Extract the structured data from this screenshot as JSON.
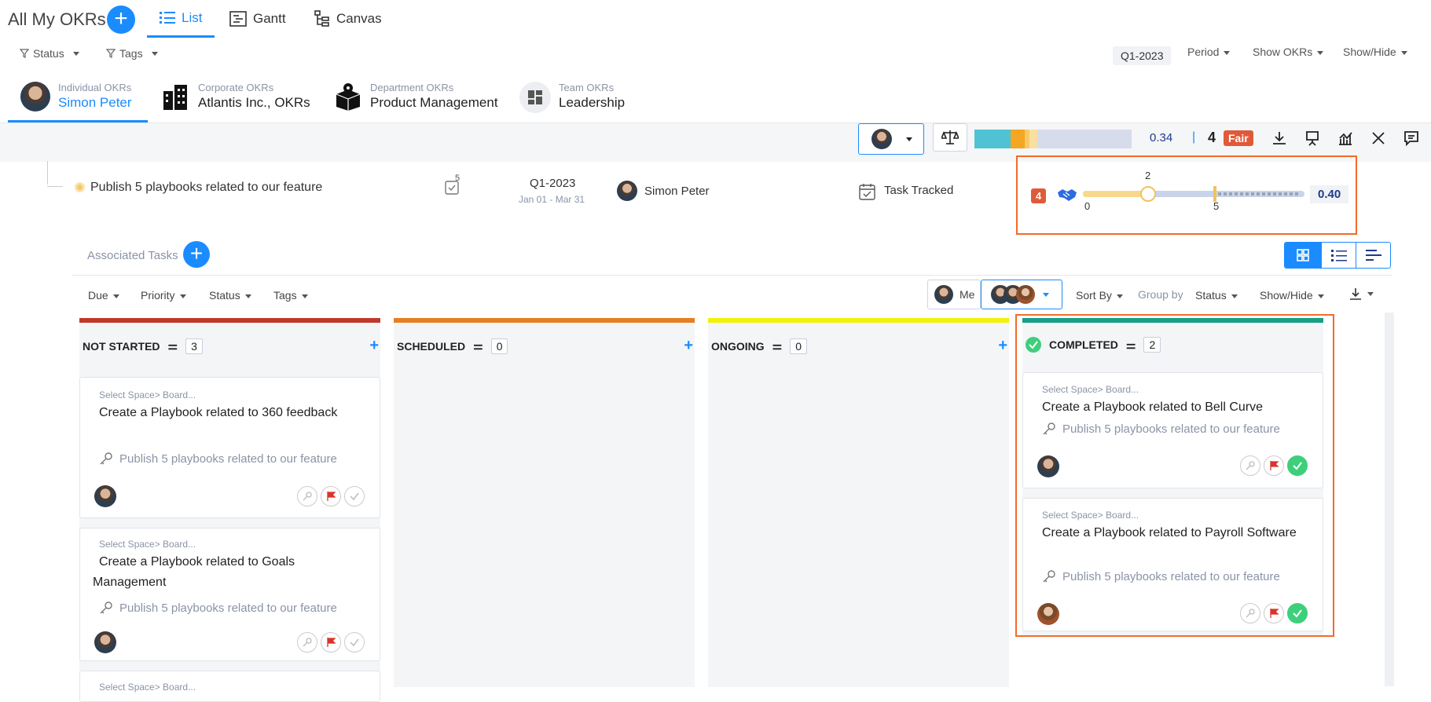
{
  "header": {
    "title": "All My OKRs",
    "tabs": [
      {
        "label": "List",
        "icon": "list-icon"
      },
      {
        "label": "Gantt",
        "icon": "gantt-icon"
      },
      {
        "label": "Canvas",
        "icon": "canvas-icon"
      }
    ]
  },
  "filters": {
    "status": "Status",
    "tags": "Tags",
    "period_value": "Q1-2023",
    "period": "Period",
    "show_okrs": "Show OKRs",
    "show_hide": "Show/Hide"
  },
  "okr_tabs": [
    {
      "sub": "Individual OKRs",
      "main": "Simon Peter"
    },
    {
      "sub": "Corporate OKRs",
      "main": "Atlantis Inc., OKRs"
    },
    {
      "sub": "Department OKRs",
      "main": "Product Management"
    },
    {
      "sub": "Team OKRs",
      "main": "Leadership"
    }
  ],
  "toolbar": {
    "score": "0.34",
    "separator": "|",
    "rating_num": "4",
    "rating_label": "Fair"
  },
  "kr_row": {
    "title": "Publish 5 playbooks related to our feature",
    "task_count": "5",
    "period": "Q1-2023",
    "dates": "Jan 01 - Mar 31",
    "owner": "Simon Peter",
    "tracking": "Task Tracked",
    "badge": "4",
    "slider_current": "2",
    "slider_start": "0",
    "slider_target": "5",
    "slider_fraction": 0.4,
    "score": "0.40"
  },
  "tasks": {
    "title": "Associated Tasks",
    "filters": [
      "Due",
      "Priority",
      "Status",
      "Tags"
    ],
    "me": "Me",
    "sort_by": "Sort By",
    "group_by_label": "Group by",
    "group_by_value": "Status",
    "show_hide": "Show/Hide"
  },
  "columns": [
    {
      "name": "NOT STARTED",
      "count": "3",
      "color": "#c0392b"
    },
    {
      "name": "SCHEDULED",
      "count": "0",
      "color": "#e67e22"
    },
    {
      "name": "ONGOING",
      "count": "0",
      "color": "#f1f10a"
    },
    {
      "name": "COMPLETED",
      "count": "2",
      "color": "#16a085"
    }
  ],
  "cards": {
    "not_started": [
      {
        "space": "Select Space> Board...",
        "title": "Create a Playbook related to 360 feedback",
        "kr": "Publish 5 playbooks related to our feature"
      },
      {
        "space": "Select Space> Board...",
        "title": "Create a Playbook related to Goals Management",
        "kr": "Publish 5 playbooks related to our feature"
      },
      {
        "space": "Select Space> Board..."
      }
    ],
    "completed": [
      {
        "space": "Select Space> Board...",
        "title": "Create a Playbook related to Bell Curve",
        "kr": "Publish 5 playbooks related to our feature"
      },
      {
        "space": "Select Space> Board...",
        "title": "Create a Playbook related to Payroll Software",
        "kr": "Publish 5 playbooks related to our feature"
      }
    ]
  }
}
